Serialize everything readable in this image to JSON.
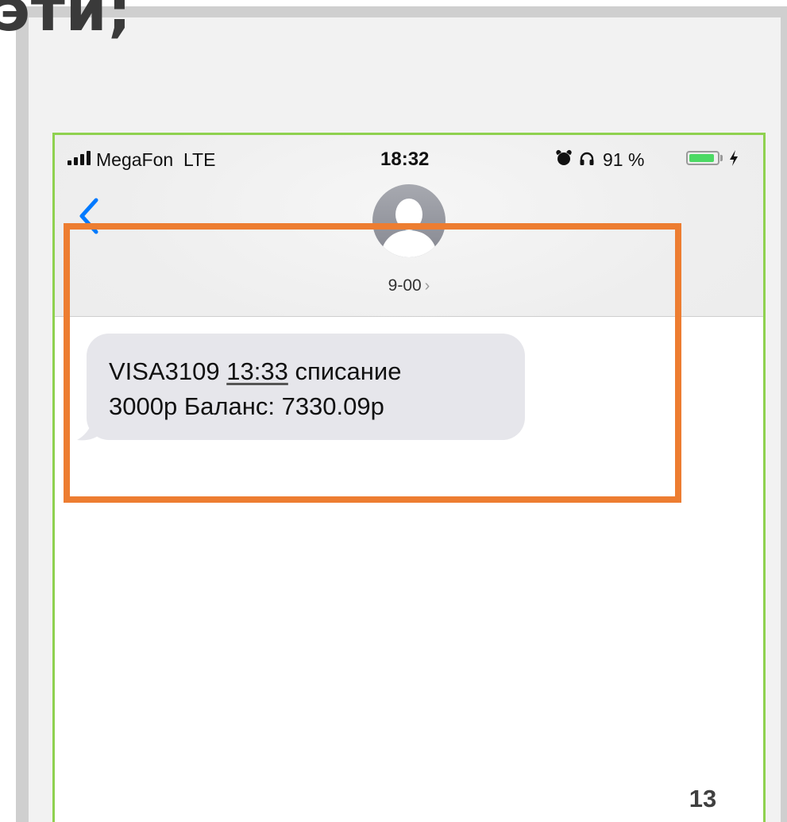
{
  "slide": {
    "heading": "эти;",
    "page_number": "13",
    "highlight_color": "#ed7d31",
    "phone_border_color": "#8fd14f"
  },
  "status_bar": {
    "carrier": "MegaFon",
    "network": "LTE",
    "time": "18:32",
    "battery_percent": "91 %",
    "battery_level": 0.91,
    "icons": [
      "signal-bars-icon",
      "alarm-icon",
      "headphones-icon",
      "battery-icon",
      "charging-bolt-icon"
    ]
  },
  "conversation": {
    "back_icon": "chevron-left-icon",
    "avatar_icon": "person-silhouette-icon",
    "contact_name": "9-00",
    "contact_chevron": "›",
    "accent_color": "#007aff"
  },
  "message": {
    "prefix": "VISA3109",
    "time": "13:33",
    "line1_rest": "списание",
    "line2": "3000р Баланс: 7330.09р",
    "bubble_color": "#e6e6eb"
  }
}
